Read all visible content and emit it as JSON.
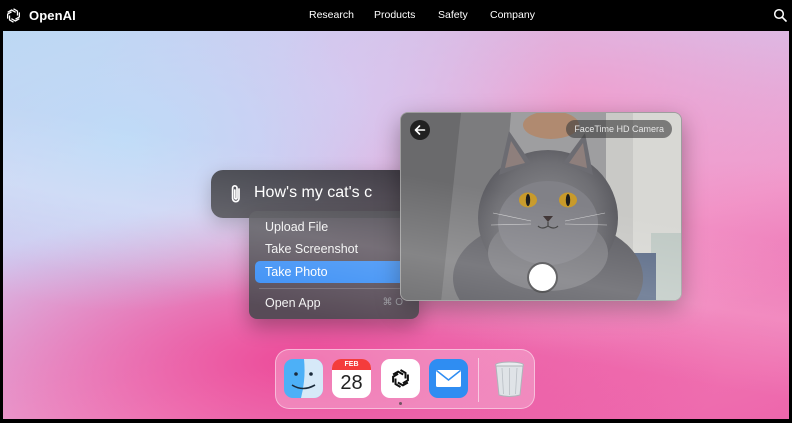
{
  "header": {
    "brand": "OpenAI",
    "nav": [
      {
        "label": "Research"
      },
      {
        "label": "Products"
      },
      {
        "label": "Safety"
      },
      {
        "label": "Company"
      }
    ],
    "search_icon": "search-icon"
  },
  "chat": {
    "text": "How's my cat's c",
    "attach_icon": "paperclip-icon"
  },
  "menu": {
    "items": [
      {
        "label": "Upload File"
      },
      {
        "label": "Take Screenshot"
      },
      {
        "label": "Take Photo",
        "selected": true
      },
      {
        "label": "Open App",
        "shortcut": "⌘ O"
      }
    ],
    "selected_color": "#3b8ff5"
  },
  "camera": {
    "label": "FaceTime HD Camera",
    "back_icon": "back-arrow-icon"
  },
  "dock": {
    "apps": [
      {
        "name": "Finder",
        "icon": "finder-icon"
      },
      {
        "name": "Calendar",
        "icon": "calendar-icon",
        "month": "FEB",
        "day": "28"
      },
      {
        "name": "ChatGPT",
        "icon": "chatgpt-icon"
      },
      {
        "name": "Mail",
        "icon": "mail-icon"
      },
      {
        "name": "Trash",
        "icon": "trash-icon"
      }
    ]
  },
  "colors": {
    "accent": "#3b8ff5",
    "topbar": "#000000",
    "calendar_red": "#f43c3c"
  }
}
